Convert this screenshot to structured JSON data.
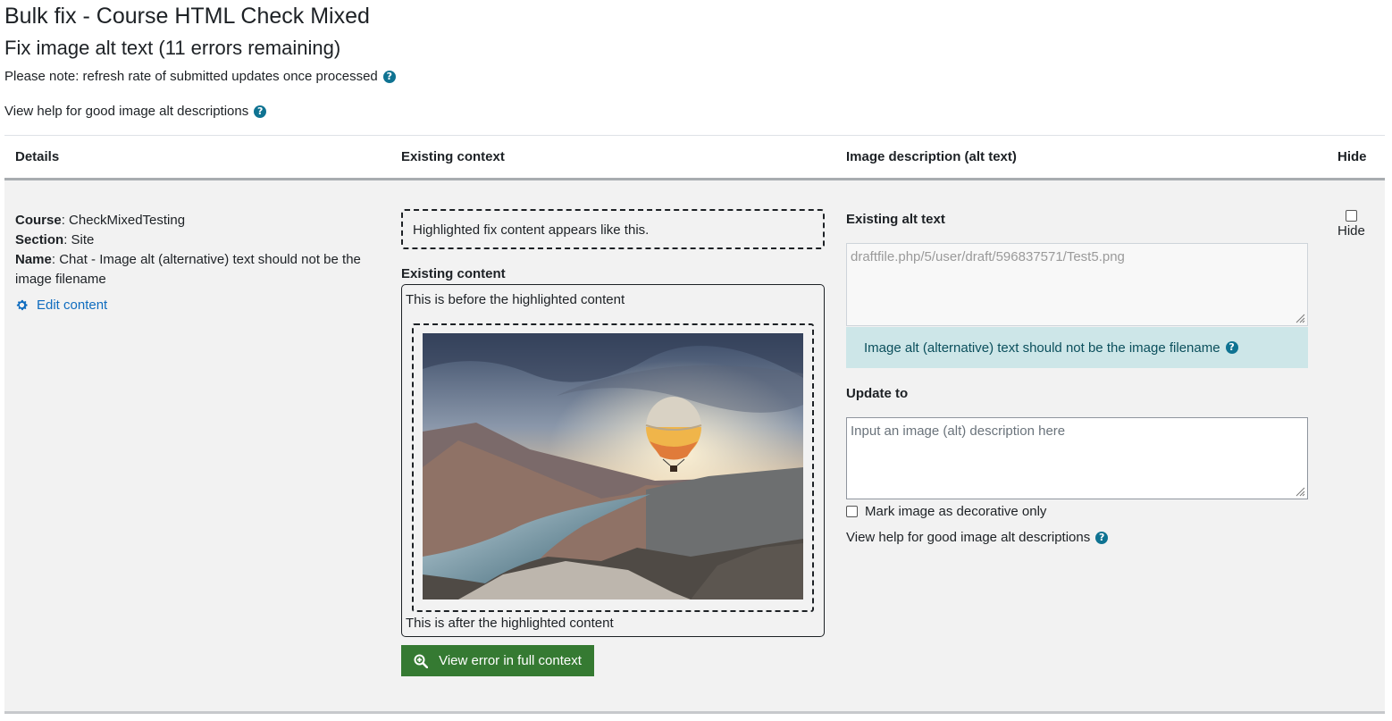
{
  "header": {
    "title": "Bulk fix - Course HTML Check Mixed",
    "subtitle": "Fix image alt text (11 errors remaining)",
    "note": "Please note: refresh rate of submitted updates once processed",
    "help_link": "View help for good image alt descriptions"
  },
  "table": {
    "columns": [
      "Details",
      "Existing context",
      "Image description (alt text)",
      "Hide"
    ],
    "row": {
      "details": {
        "course_label": "Course",
        "course_value": ": CheckMixedTesting",
        "section_label": "Section",
        "section_value": ": Site",
        "name_label": "Name",
        "name_value": ": Chat - Image alt (alternative) text should not be the image filename",
        "edit_label": "Edit content"
      },
      "context": {
        "highlight_note": "Highlighted fix content appears like this.",
        "existing_label": "Existing content",
        "before_text": "This is before the highlighted content",
        "after_text": "This is after the highlighted content",
        "view_button": "View error in full context"
      },
      "alt": {
        "existing_label": "Existing alt text",
        "existing_value": "draftfile.php/5/user/draft/596837571/Test5.png",
        "error_message": "Image alt (alternative) text should not be the image filename",
        "update_label": "Update to",
        "update_placeholder": "Input an image (alt) description here",
        "decorative_label": "Mark image as decorative only",
        "help_link": "View help for good image alt descriptions"
      },
      "hide": {
        "label": "Hide",
        "checked": false
      }
    }
  },
  "colors": {
    "link": "#0f6cbf",
    "help_icon": "#0f7392",
    "button": "#357a32",
    "alert_bg": "#cde6e8",
    "row_bg": "#f2f2f2"
  }
}
